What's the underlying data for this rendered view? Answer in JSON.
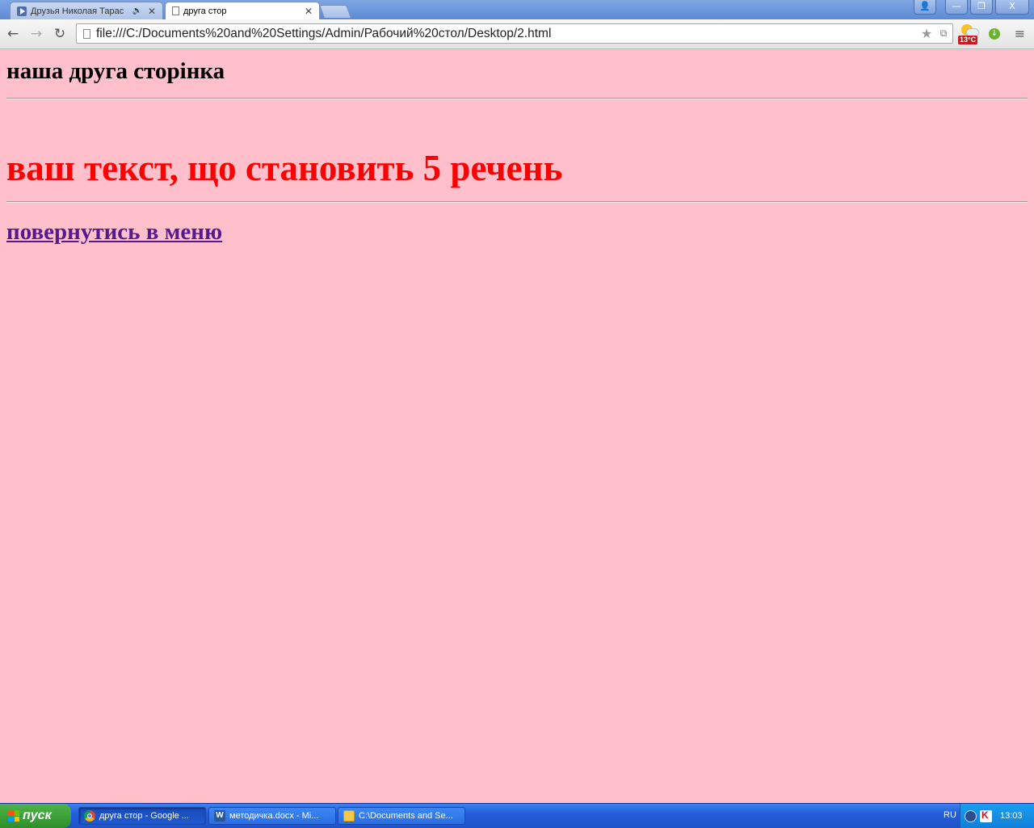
{
  "browser": {
    "tabs": [
      {
        "title": "Друзья Николая Тарас",
        "state": "inactive",
        "audio": true
      },
      {
        "title": "друга стор",
        "state": "active",
        "audio": false
      }
    ],
    "close_glyph": "✕",
    "address": {
      "url": "file:///C:/Documents%20and%20Settings/Admin/Рабочий%20стол/Desktop/2.html"
    },
    "weather": {
      "temp": "13°C"
    },
    "window_buttons": {
      "minimize": "—",
      "restore": "❐",
      "close": "X"
    }
  },
  "page": {
    "background": "#ffc0cb",
    "heading": "наша друга сторінка",
    "main_text": "ваш текст, що становить 5 речень",
    "main_text_color": "#ff0000",
    "link": "повернутись в меню",
    "link_color": "#551a8b"
  },
  "taskbar": {
    "start_label": "пуск",
    "tasks": [
      {
        "label": "друга стор - Google ...",
        "icon": "chrome-icon",
        "active": true
      },
      {
        "label": "методичка.docx - Mi...",
        "icon": "word-icon",
        "active": false
      },
      {
        "label": "C:\\Documents and Se...",
        "icon": "folder-icon",
        "active": false
      }
    ],
    "language": "RU",
    "clock": "13:03"
  }
}
